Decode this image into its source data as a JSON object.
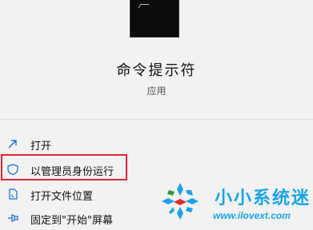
{
  "app": {
    "title": "命令提示符",
    "type": "应用"
  },
  "menu": {
    "items": [
      {
        "label": "打开",
        "icon": "open-arrow-icon"
      },
      {
        "label": "以管理员身份运行",
        "icon": "shield-icon"
      },
      {
        "label": "打开文件位置",
        "icon": "file-location-icon"
      },
      {
        "label": "固定到\"开始\"屏幕",
        "icon": "pin-icon"
      }
    ]
  },
  "watermark": {
    "title": "小小系统迷",
    "url": "www.ilovext.com"
  },
  "colors": {
    "highlight": "#d9272e",
    "icon_blue": "#1f6fd1",
    "watermark": "#1aa3e8"
  }
}
